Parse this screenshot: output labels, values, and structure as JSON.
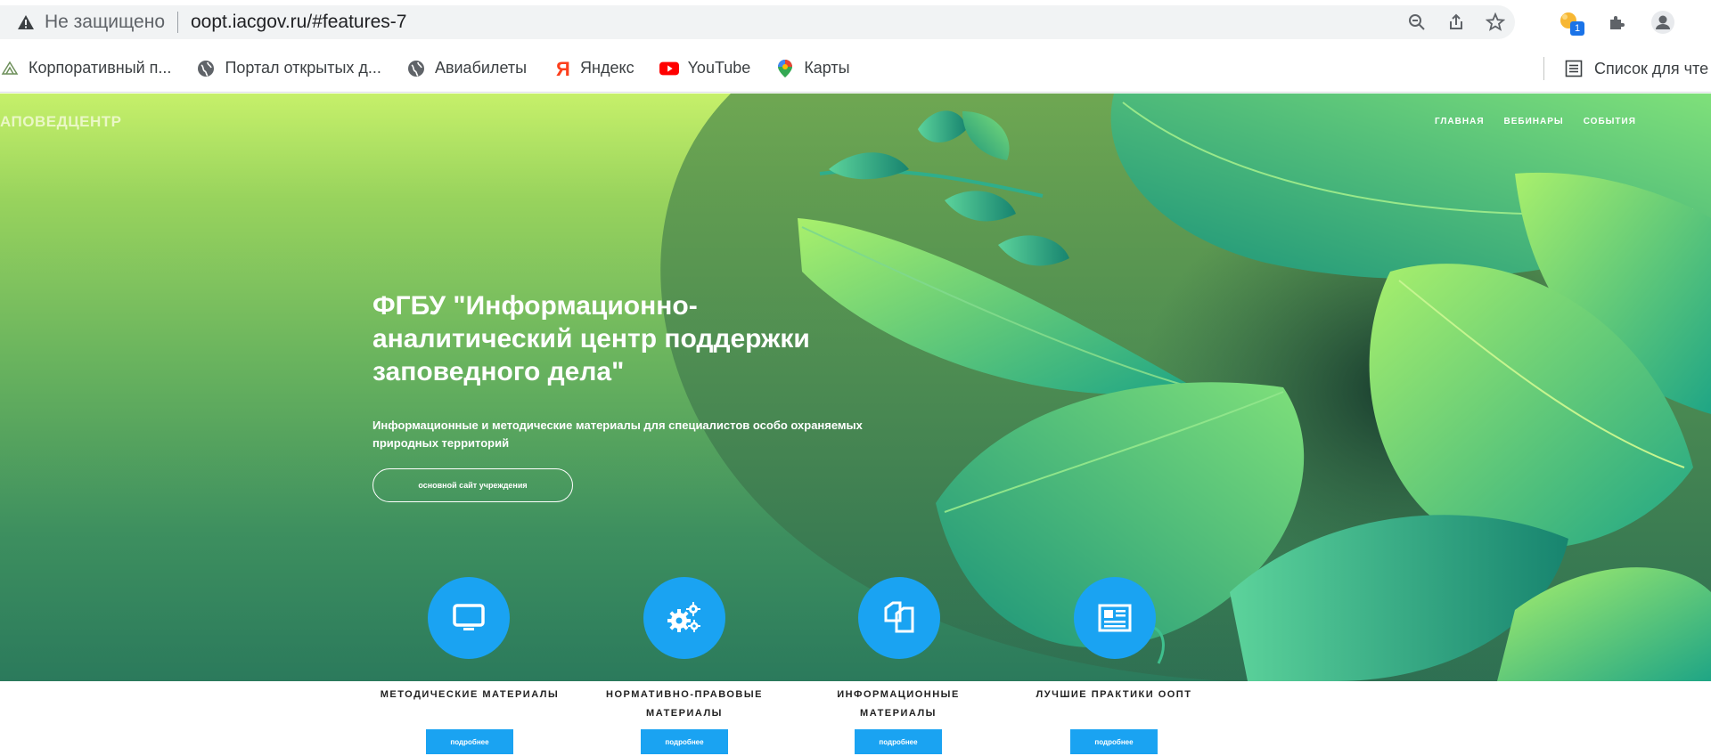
{
  "browser": {
    "security_label": "Не защищено",
    "url": "oopt.iacgov.ru/#features-7",
    "extension_badge": "1",
    "icons": [
      "warning-icon",
      "zoom-icon",
      "share-icon",
      "star-icon",
      "extension-icon",
      "puzzle-icon",
      "profile-icon"
    ]
  },
  "bookmarks": {
    "items": [
      {
        "label": "Корпоративный п...",
        "icon": "corporate-icon"
      },
      {
        "label": "Портал открытых д...",
        "icon": "globe-icon"
      },
      {
        "label": "Авиабилеты",
        "icon": "globe-icon"
      },
      {
        "label": "Яндекс",
        "icon": "yandex-icon"
      },
      {
        "label": "YouTube",
        "icon": "youtube-icon"
      },
      {
        "label": "Карты",
        "icon": "maps-icon"
      }
    ],
    "reading_list": "Список для чте"
  },
  "site": {
    "logo": "АПОВЕДЦЕНТР",
    "nav": [
      "ГЛАВНАЯ",
      "ВЕБИНАРЫ",
      "СОБЫТИЯ"
    ],
    "hero": {
      "title": "ФГБУ \"Информационно-аналитический центр поддержки заповедного дела\"",
      "subtitle": "Информационные и методические материалы для специалистов особо охраняемых природных территорий",
      "button": "основной сайт учреждения"
    },
    "features": [
      {
        "label": "МЕТОДИЧЕСКИЕ МАТЕРИАЛЫ",
        "icon": "monitor-icon",
        "button": "подробнее"
      },
      {
        "label": "НОРМАТИВНО-ПРАВОВЫЕ МАТЕРИАЛЫ",
        "icon": "gears-icon",
        "button": "подробнее"
      },
      {
        "label": "ИНФОРМАЦИОННЫЕ МАТЕРИАЛЫ",
        "icon": "documents-icon",
        "button": "подробнее"
      },
      {
        "label": "ЛУЧШИЕ ПРАКТИКИ ООПТ",
        "icon": "newspaper-icon",
        "button": "подробнее"
      }
    ],
    "colors": {
      "accent": "#1aa3f2",
      "hero_top": "#c6f06a",
      "hero_bottom": "#2b7a5c"
    }
  }
}
